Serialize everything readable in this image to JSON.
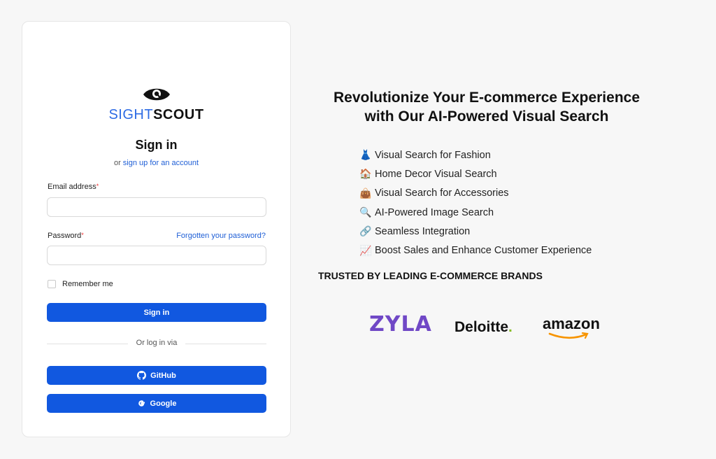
{
  "login": {
    "brand_sight": "SIGHT",
    "brand_scout": "SCOUT",
    "title": "Sign in",
    "signup_prefix": "or",
    "signup_link": "sign up for an account",
    "email_label": "Email address",
    "password_label": "Password",
    "required_mark": "*",
    "email_value": "",
    "password_value": "",
    "forgot_link": "Forgotten your password?",
    "remember_label": "Remember me",
    "signin_button": "Sign in",
    "divider_text": "Or log in via",
    "github_button": "GitHub",
    "google_button": "Google"
  },
  "marketing": {
    "headline_line1": "Revolutionize Your E-commerce Experience",
    "headline_line2": "with Our AI-Powered Visual Search",
    "features": [
      {
        "icon": "dress-emoji",
        "glyph": "👗",
        "label": "Visual Search for Fashion"
      },
      {
        "icon": "house-emoji",
        "glyph": "🏠",
        "label": "Home Decor Visual Search"
      },
      {
        "icon": "handbag-emoji",
        "glyph": "👜",
        "label": "Visual Search for Accessories"
      },
      {
        "icon": "magnifier-emoji",
        "glyph": "🔍",
        "label": "AI-Powered Image Search"
      },
      {
        "icon": "link-emoji",
        "glyph": "🔗",
        "label": "Seamless Integration"
      },
      {
        "icon": "chart-emoji",
        "glyph": "📈",
        "label": "Boost Sales and Enhance Customer Experience"
      }
    ],
    "trusted_heading": "TRUSTED BY LEADING E-COMMERCE BRANDS",
    "brands": {
      "zyla": "ZYLA",
      "deloitte": "Deloitte",
      "deloitte_dot": ".",
      "amazon": "amazon"
    }
  },
  "colors": {
    "accent": "#1158e0",
    "brand_blue": "#2d6be4",
    "zyla_purple": "#7048c6",
    "deloitte_green": "#86bc25",
    "amazon_orange": "#f79400"
  }
}
